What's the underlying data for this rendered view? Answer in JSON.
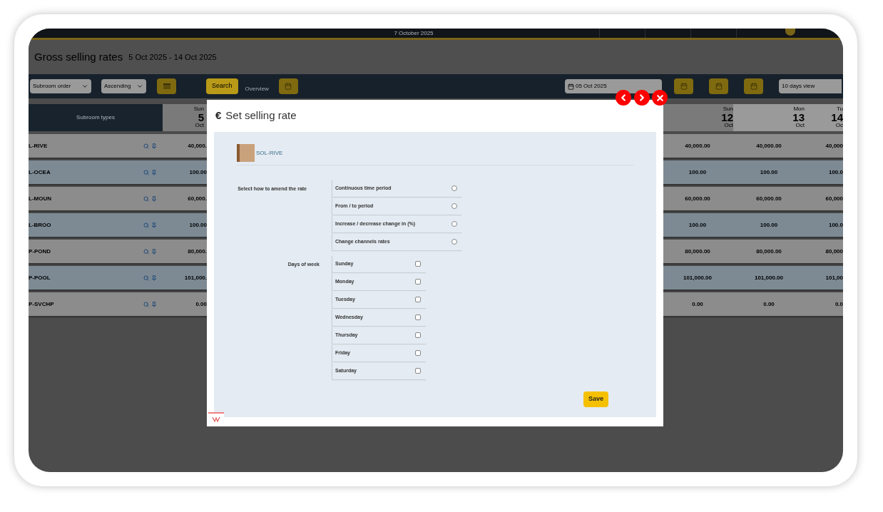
{
  "top_bar": {
    "date": "7 October 2025"
  },
  "page": {
    "title": "Gross selling rates",
    "date_range": "5 Oct 2025 - 14 Oct 2025"
  },
  "toolbar": {
    "sort_field": "Subroom order",
    "sort_direction": "Ascending",
    "search_button": "Search",
    "overview_label": "Overview",
    "date_field": "05 Oct 2025",
    "view_select": "10 days view"
  },
  "grid": {
    "first_column": "Subroom types",
    "days": [
      {
        "weekday": "Sun",
        "day": "5",
        "month": "Oct",
        "weekend": true
      },
      {
        "weekday": "Sun",
        "day": "12",
        "month": "Oct",
        "weekend": true
      },
      {
        "weekday": "Mon",
        "day": "13",
        "month": "Oct",
        "weekend": false
      },
      {
        "weekday": "Tu",
        "day": "14",
        "month": "Oc",
        "weekend": false
      }
    ],
    "rows": [
      {
        "name": "L-RIVE",
        "values": [
          "40,000.",
          "40,000.00",
          "40,000.00",
          "40,000"
        ]
      },
      {
        "name": "L-OCEA",
        "values": [
          "100.00",
          "100.00",
          "100.00",
          "100.0"
        ]
      },
      {
        "name": "L-MOUN",
        "values": [
          "60,000.",
          "60,000.00",
          "60,000.00",
          "60,000"
        ]
      },
      {
        "name": "L-BROO",
        "values": [
          "100.00",
          "100.00",
          "100.00",
          "100.0"
        ]
      },
      {
        "name": "P-POND",
        "values": [
          "80,000.",
          "80,000.00",
          "80,000.00",
          "80,000"
        ]
      },
      {
        "name": "P-POOL",
        "values": [
          "101,000.",
          "101,000.00",
          "101,000.00",
          "101,00"
        ]
      },
      {
        "name": "P-SVCHP",
        "values": [
          "0.00",
          "0.00",
          "0.00",
          "0.0"
        ]
      }
    ]
  },
  "modal": {
    "title_icon": "€",
    "title": "Set selling rate",
    "room": "SOL-RIVE",
    "amend_label": "Select how to amend the rate",
    "amend_options": [
      {
        "label": "Continuous time period",
        "selected": false
      },
      {
        "label": "From / to period",
        "selected": false
      },
      {
        "label": "Increase / decrease change in (%)",
        "selected": false
      },
      {
        "label": "Change channels rates",
        "selected": false
      }
    ],
    "days_label": "Days of week",
    "days": [
      {
        "label": "Sunday",
        "checked": false
      },
      {
        "label": "Monday",
        "checked": false
      },
      {
        "label": "Tuesday",
        "checked": false
      },
      {
        "label": "Wednesday",
        "checked": false
      },
      {
        "label": "Thursday",
        "checked": false
      },
      {
        "label": "Friday",
        "checked": false
      },
      {
        "label": "Saturday",
        "checked": false
      }
    ],
    "save_button": "Save"
  }
}
